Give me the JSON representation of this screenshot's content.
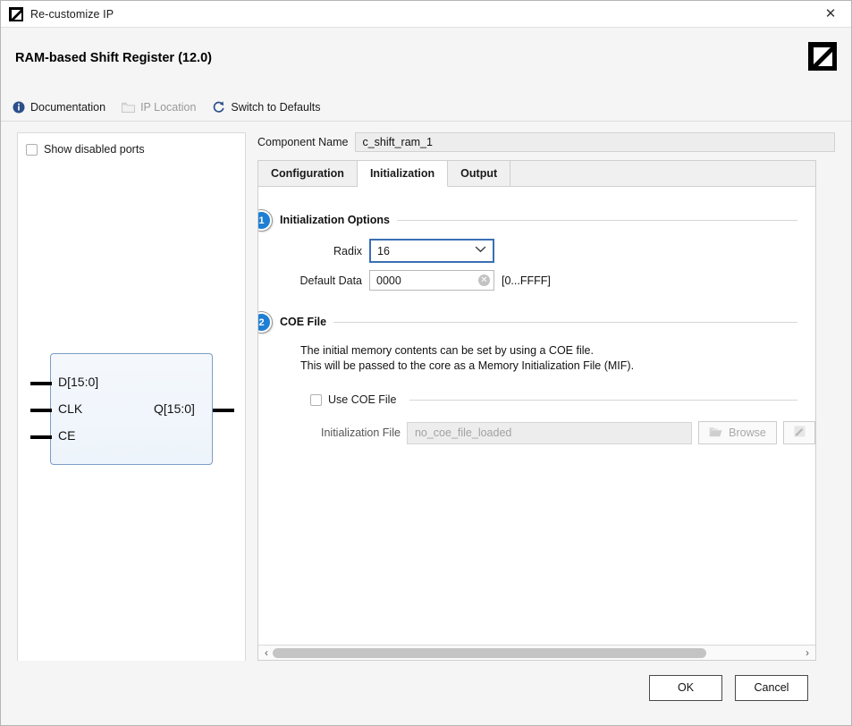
{
  "titlebar": {
    "title": "Re-customize IP",
    "icon": "xilinx-logo-icon",
    "close_label": "✕"
  },
  "header": {
    "title": "RAM-based Shift Register (12.0)",
    "logo": "xilinx-logo-icon",
    "toolbar": [
      {
        "label": "Documentation",
        "icon": "info-icon",
        "disabled": false
      },
      {
        "label": "IP Location",
        "icon": "folder-icon",
        "disabled": true
      },
      {
        "label": "Switch to Defaults",
        "icon": "refresh-icon",
        "disabled": false
      }
    ]
  },
  "left_panel": {
    "show_disabled_ports_label": "Show disabled ports",
    "show_disabled_ports_checked": false,
    "symbol": {
      "inputs": [
        "D[15:0]",
        "CLK",
        "CE"
      ],
      "outputs": [
        "Q[15:0]"
      ]
    }
  },
  "component": {
    "name_label": "Component Name",
    "name_value": "c_shift_ram_1"
  },
  "tabs": [
    {
      "label": "Configuration",
      "active": false
    },
    {
      "label": "Initialization",
      "active": true
    },
    {
      "label": "Output",
      "active": false
    }
  ],
  "initialization": {
    "badge_1": "1",
    "section_title": "Initialization Options",
    "radix": {
      "label": "Radix",
      "value": "16",
      "chevron": "⌄"
    },
    "default_data": {
      "label": "Default Data",
      "value": "0000",
      "clear_icon": "✕",
      "range_hint": "[0...FFFF]"
    }
  },
  "coe": {
    "badge_2": "2",
    "section_title": "COE File",
    "description_line_1": "The initial memory contents can be set by using a COE file.",
    "description_line_2": "This will be passed to the core as a Memory Initialization File (MIF).",
    "use_coe_label": "Use COE File",
    "use_coe_checked": false,
    "init_file_label": "Initialization File",
    "init_file_placeholder": "no_coe_file_loaded",
    "browse_label": "Browse",
    "browse_icon": "folder-open-icon",
    "edit_icon": "pencil-edit-icon"
  },
  "scrollbar": {
    "left_arrow": "‹",
    "right_arrow": "›"
  },
  "footer": {
    "ok_label": "OK",
    "cancel_label": "Cancel"
  },
  "colors": {
    "accent": "#1f7fd4",
    "focus_border": "#3a6fb5",
    "symbol_border": "#7b9ec4",
    "header_bg": "#f5f5f5"
  }
}
